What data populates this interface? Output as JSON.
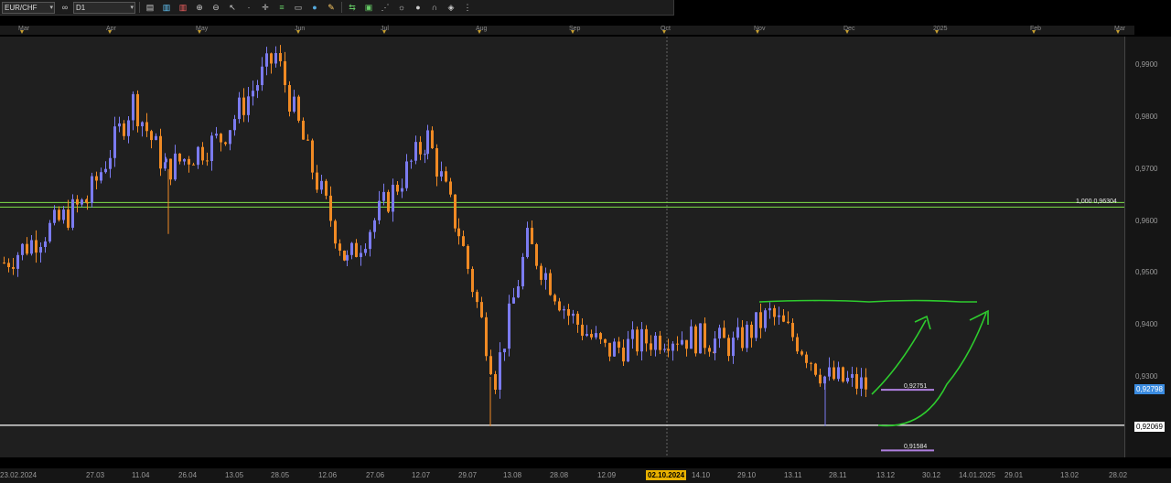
{
  "toolbar": {
    "symbol": "EUR/CHF",
    "timeframe": "D1",
    "icons": [
      "chart-type-icon",
      "bar-style-icon",
      "candle-style-icon",
      "line-style-icon",
      "zoom-in-icon",
      "zoom-out-icon",
      "cursor-icon",
      "dot-icon",
      "crosshair-icon",
      "level-icon",
      "text-icon",
      "circle-icon",
      "pencil-icon",
      "arrows-icon",
      "rectangle-icon",
      "fibonacci-icon",
      "settings-icon",
      "gear-icon",
      "magnet-icon",
      "eraser-icon",
      "more-icon"
    ]
  },
  "months": [
    "Mar",
    "Apr",
    "May",
    "Jun",
    "Jul",
    "Aug",
    "Sep",
    "Oct",
    "Nov",
    "Dec",
    "2025",
    "Feb",
    "Mar"
  ],
  "price_labels": [
    "0,9900",
    "0,9800",
    "0,9700",
    "0,9600",
    "0,9500",
    "0,9400",
    "0,9300"
  ],
  "price_badges": {
    "current": "0,92798",
    "line": "0,92069"
  },
  "date_labels": [
    "23.02.2024",
    "27.03",
    "11.04",
    "26.04",
    "13.05",
    "28.05",
    "12.06",
    "27.06",
    "12.07",
    "29.07",
    "13.08",
    "28.08",
    "12.09",
    "02.10.2024",
    "14.10",
    "29.10",
    "13.11",
    "28.11",
    "13.12",
    "30.12",
    "14.01.2025",
    "29.01",
    "13.02",
    "28.02"
  ],
  "highlight_date": "02.10.2024",
  "level_labels": {
    "fib": "1,000 0,96304",
    "upper": "0,92751",
    "lower": "0,91584"
  },
  "colors": {
    "bull": "#7b7bf0",
    "bear": "#f08a24",
    "support": "#ffffff",
    "resistance": "#7fe04a",
    "drawing": "#2ecc2e",
    "level_marker": "#b080e0"
  },
  "chart_data": {
    "type": "candlestick",
    "symbol": "EUR/CHF",
    "timeframe": "D1",
    "ylim": [
      0.9145,
      0.9955
    ],
    "close_path": [
      [
        "23.02.2024",
        0.952
      ],
      [
        "27.03",
        0.964
      ],
      [
        "11.04",
        0.983
      ],
      [
        "26.04",
        0.97
      ],
      [
        "13.05",
        0.976
      ],
      [
        "28.05",
        0.992
      ],
      [
        "12.06",
        0.97
      ],
      [
        "27.06",
        0.952
      ],
      [
        "12.07",
        0.976
      ],
      [
        "29.07",
        0.958
      ],
      [
        "06.08",
        0.93
      ],
      [
        "13.08",
        0.956
      ],
      [
        "28.08",
        0.942
      ],
      [
        "12.09",
        0.935
      ],
      [
        "02.10.2024",
        0.938
      ],
      [
        "14.10",
        0.937
      ],
      [
        "29.10",
        0.936
      ],
      [
        "07.11",
        0.942
      ],
      [
        "13.11",
        0.937
      ],
      [
        "28.11",
        0.93
      ],
      [
        "06.12",
        0.928
      ]
    ],
    "horizontal_lines": [
      0.96304,
      0.92069
    ],
    "current_price": 0.92798,
    "marked_levels": [
      0.92751,
      0.91584
    ]
  }
}
